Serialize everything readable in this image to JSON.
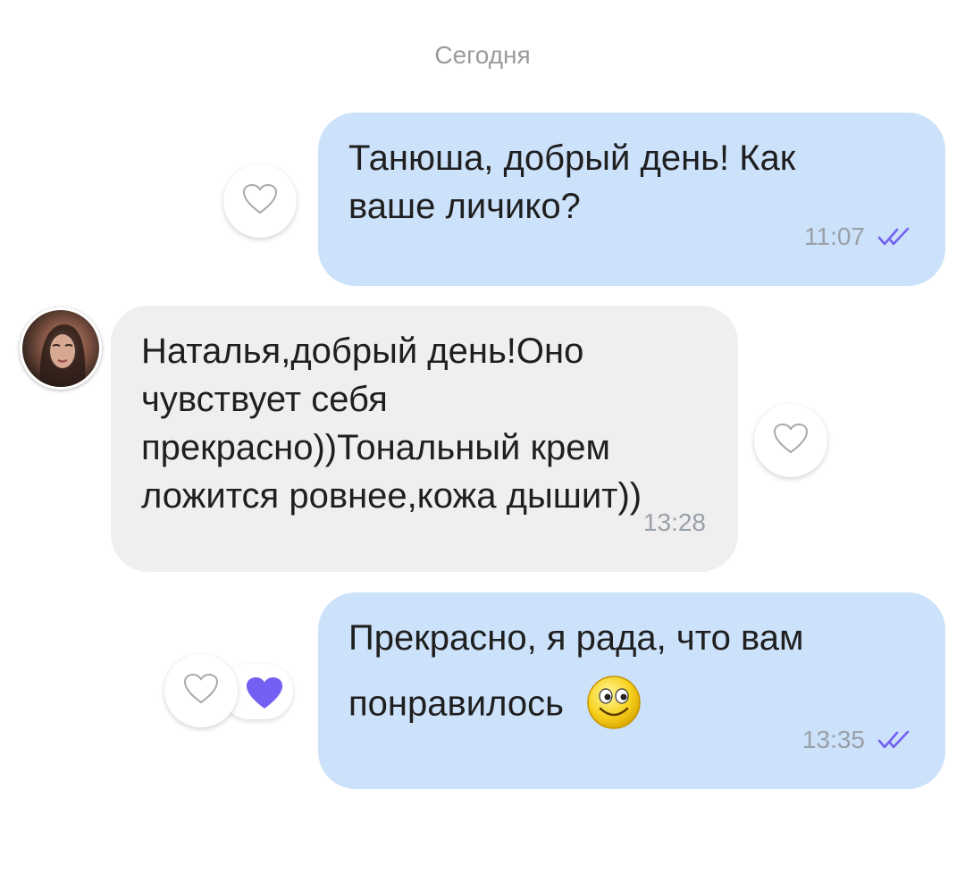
{
  "chat": {
    "date_separator": "Сегодня",
    "messages": [
      {
        "direction": "outgoing",
        "text_line1": "Танюша, добрый день! Как",
        "text_line2": "ваше личико?",
        "time": "11:07",
        "status_icon": "double-check-icon",
        "reaction_icon": "heart-outline-icon"
      },
      {
        "direction": "incoming",
        "sender_avatar_icon": "avatar",
        "text_line1": "Наталья,добрый день!Оно",
        "text_line2": "чувствует себя",
        "text_line3": "прекрасно))Тональный крем",
        "text_line4": "ложится ровнее,кожа дышит))",
        "time": "13:28",
        "reaction_icon": "heart-outline-icon"
      },
      {
        "direction": "outgoing",
        "text_line1": "Прекрасно, я рада, что вам",
        "text_line2": "понравилось",
        "emoji_icon": "smiley-icon",
        "time": "13:35",
        "status_icon": "double-check-icon",
        "reaction_icon": "heart-outline-icon",
        "applied_reaction_icon": "heart-filled-icon"
      }
    ]
  },
  "colors": {
    "outgoing_bubble": "#cce1fa",
    "incoming_bubble": "#efefef",
    "accent_check": "#7360f2",
    "reaction_heart_filled": "#7360f2",
    "timestamp": "#9aa0a8"
  }
}
